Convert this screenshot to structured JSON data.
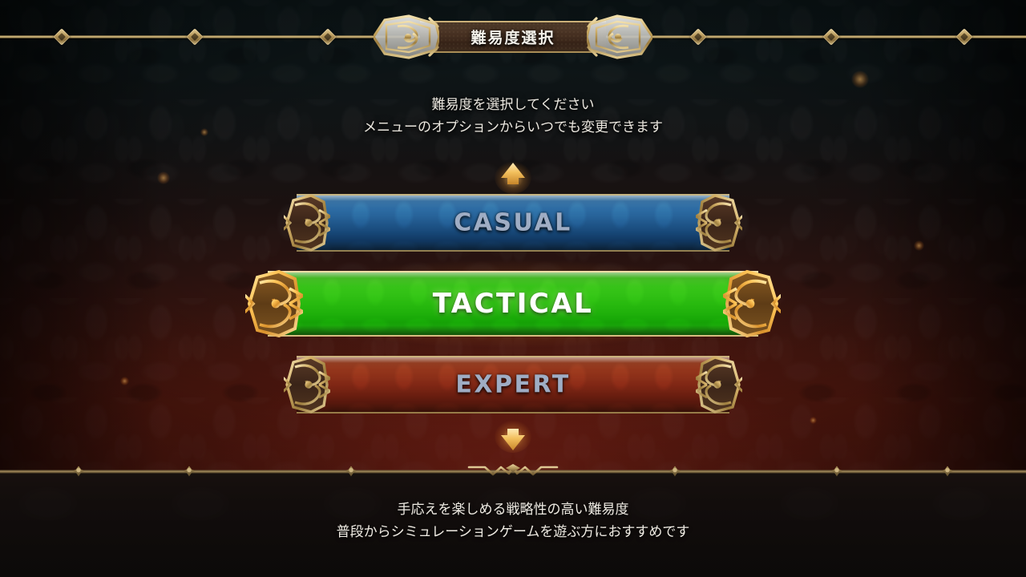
{
  "header": {
    "title": "難易度選択"
  },
  "instructions": {
    "line1": "難易度を選択してください",
    "line2": "メニューのオプションからいつでも変更できます"
  },
  "indicators": {
    "scroll_up": "arrow-up-icon",
    "scroll_down": "arrow-down-icon"
  },
  "difficulties": [
    {
      "label": "CASUAL",
      "selected": false,
      "color": "#2f6fa8"
    },
    {
      "label": "TACTICAL",
      "selected": true,
      "color": "#27b90e"
    },
    {
      "label": "EXPERT",
      "selected": false,
      "color": "#7e2614"
    }
  ],
  "description": {
    "line1": "手応えを楽しめる戦略性の高い難易度",
    "line2": "普段からシミュレーションゲームを遊ぶ方におすすめです"
  },
  "theme": {
    "gold": "#c7ab६f",
    "gold_light": "#e4cf99",
    "text_unselected": "#9fadc4",
    "text_selected": "#ffffff",
    "banner_plate": "#4a3324"
  }
}
